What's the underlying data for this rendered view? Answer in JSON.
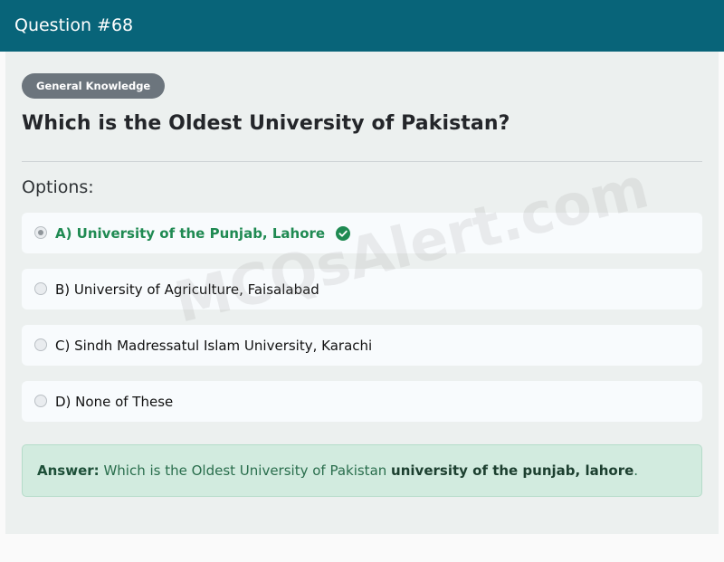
{
  "header": {
    "title": "Question #68"
  },
  "category_badge": "General Knowledge",
  "question": {
    "text": "Which is the Oldest University of Pakistan?"
  },
  "options_label": "Options:",
  "options": [
    {
      "label": "A) University of the Punjab, Lahore",
      "correct": true,
      "selected": true
    },
    {
      "label": "B) University of Agriculture, Faisalabad",
      "correct": false,
      "selected": false
    },
    {
      "label": "C) Sindh Madressatul Islam University, Karachi",
      "correct": false,
      "selected": false
    },
    {
      "label": "D) None of These",
      "correct": false,
      "selected": false
    }
  ],
  "answer": {
    "prefix": "Answer:",
    "text": "Which is the Oldest University of Pakistan",
    "highlight": "university of the punjab, lahore",
    "suffix": "."
  },
  "watermark": "MCQsAlert.com",
  "icons": {
    "correct": "check-circle-icon"
  },
  "colors": {
    "header_bg": "#086479",
    "correct_green": "#1f8a52",
    "answer_bg": "#d2ebdf",
    "badge_bg": "#6c757d"
  }
}
